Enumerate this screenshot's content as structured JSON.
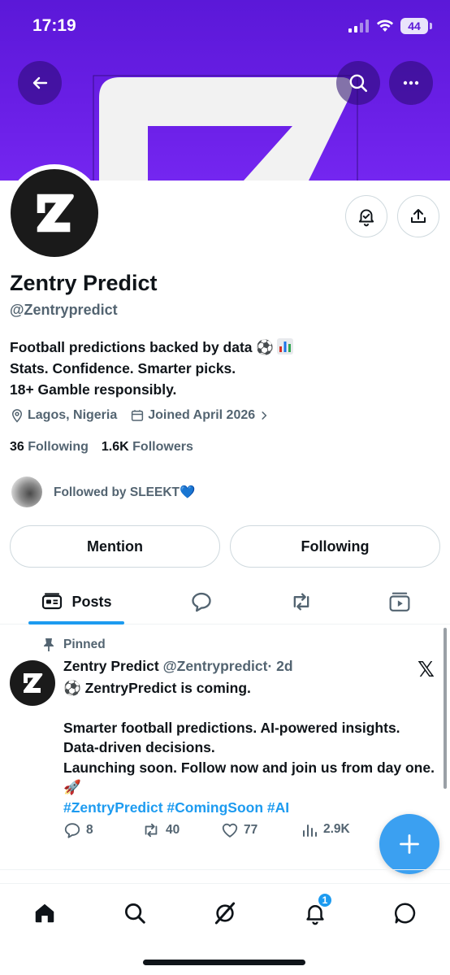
{
  "status_bar": {
    "time": "17:19",
    "battery": "44"
  },
  "colors": {
    "banner": "#6a1fe6",
    "accent": "#1d9bf0",
    "text": "#0f1419",
    "muted": "#536471"
  },
  "profile": {
    "name": "Zentry Predict",
    "handle": "@Zentrypredict",
    "bio_lines": [
      "Football predictions backed by data ⚽",
      "Stats. Confidence. Smarter picks.",
      "18+ Gamble responsibly."
    ],
    "location": "Lagos, Nigeria",
    "joined": "Joined April 2026",
    "following_count": "36",
    "following_label": "Following",
    "followers_count": "1.6K",
    "followers_label": "Followers",
    "followed_by": "Followed by SLEEKT💙"
  },
  "buttons": {
    "mention": "Mention",
    "following": "Following"
  },
  "tabs": {
    "posts": "Posts"
  },
  "post": {
    "pinned_label": "Pinned",
    "author_name": "Zentry Predict",
    "author_handle": "@Zentrypredict",
    "time": "· 2d",
    "line1": "⚽ ZentryPredict is coming.",
    "line2": "Smarter football predictions. AI-powered insights. Data-driven decisions.",
    "line3": "Launching soon. Follow now and join us from day one. 🚀",
    "hashtags": "#ZentryPredict #ComingSoon #AI",
    "replies": "8",
    "reposts": "40",
    "likes": "77",
    "views": "2.9K"
  },
  "nav": {
    "notification_badge": "1"
  },
  "icons": [
    "back-arrow-icon",
    "search-icon",
    "more-icon",
    "bell-icon",
    "share-icon",
    "location-icon",
    "calendar-icon",
    "chevron-right-icon",
    "posts-icon",
    "replies-icon",
    "repost-icon",
    "media-icon",
    "pin-icon",
    "reply-icon",
    "like-icon",
    "views-icon",
    "plus-icon",
    "home-icon",
    "grok-icon",
    "messages-icon"
  ]
}
